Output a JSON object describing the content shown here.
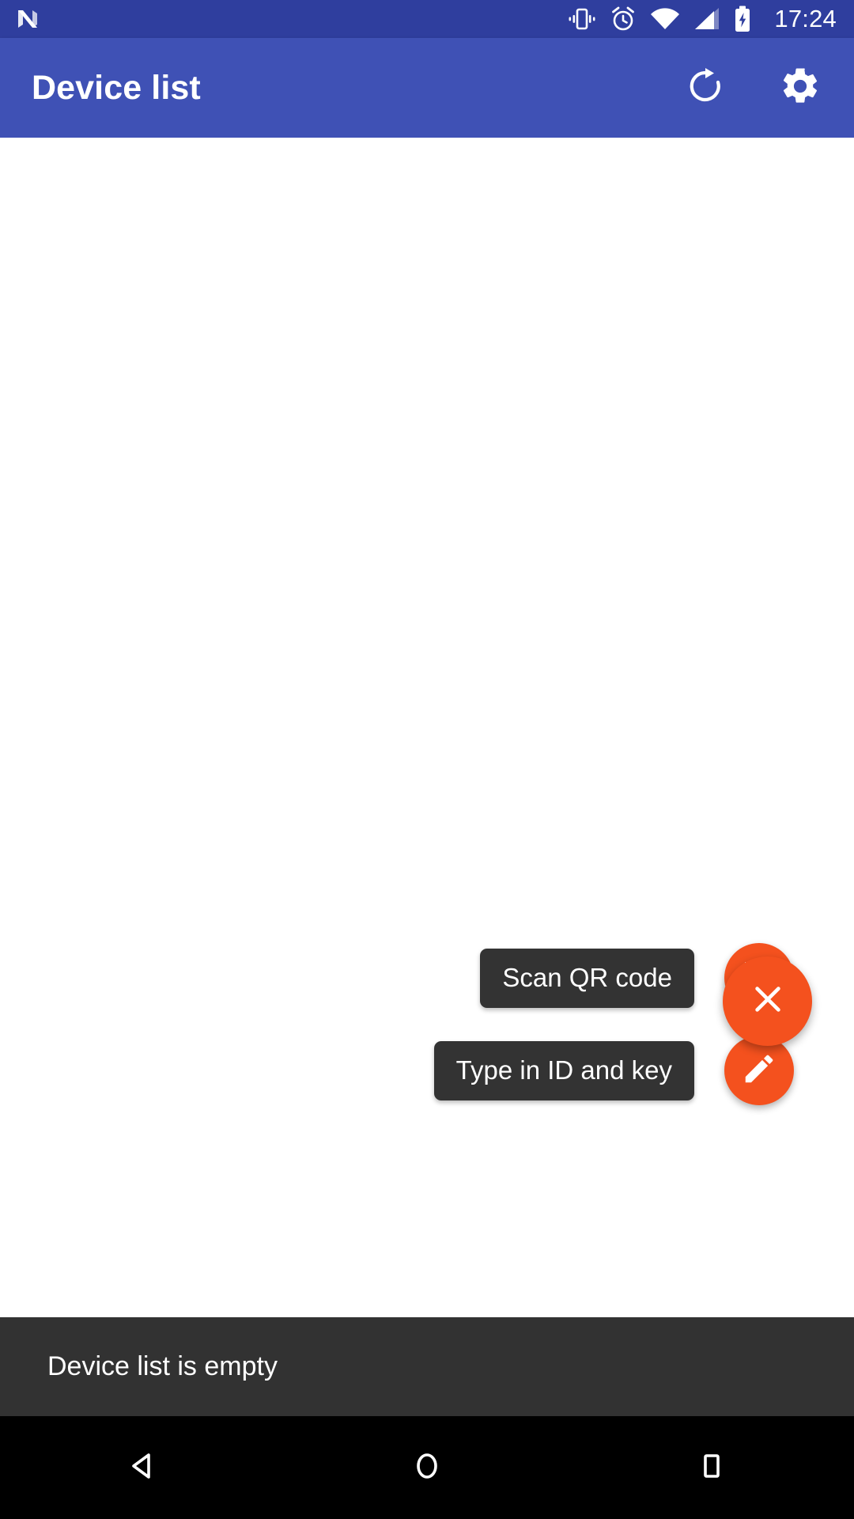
{
  "status_bar": {
    "logo": "android-nougat-n-logo",
    "icons": [
      "vibrate-icon",
      "alarm-icon",
      "wifi-icon",
      "cellular-signal-icon",
      "battery-charging-icon"
    ],
    "clock": "17:24",
    "background_color": "#2F3E9E"
  },
  "app_bar": {
    "title": "Device list",
    "background_color": "#3F51B5",
    "actions": [
      {
        "name": "refresh-button",
        "icon": "refresh-icon"
      },
      {
        "name": "settings-button",
        "icon": "gear-icon"
      }
    ]
  },
  "fab_menu": {
    "expanded": true,
    "accent_color": "#F4511E",
    "label_background_color": "#333333",
    "items": [
      {
        "label": "Scan QR code",
        "icon": "qr-code-icon"
      },
      {
        "label": "Type in ID and key",
        "icon": "pencil-icon"
      }
    ],
    "main": {
      "icon": "close-icon",
      "label": "close-fab"
    }
  },
  "snackbar": {
    "message": "Device list is empty",
    "background_color": "#323232"
  },
  "nav_bar": {
    "background_color": "#000000",
    "buttons": [
      {
        "name": "nav-back-button",
        "icon": "back-triangle-icon"
      },
      {
        "name": "nav-home-button",
        "icon": "home-circle-icon"
      },
      {
        "name": "nav-recents-button",
        "icon": "recents-square-icon"
      }
    ]
  }
}
